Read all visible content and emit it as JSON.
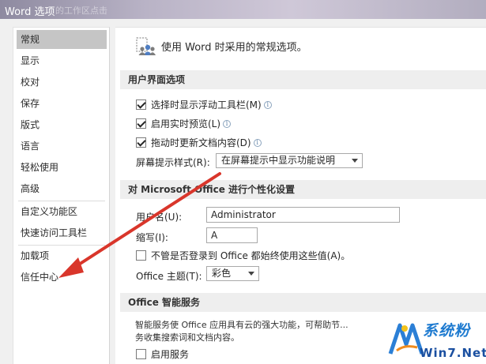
{
  "window": {
    "title": "Word 选项",
    "title_ghost": "的工作区点击"
  },
  "sidebar": {
    "items": [
      {
        "label": "常规",
        "selected": true
      },
      {
        "label": "显示"
      },
      {
        "label": "校对"
      },
      {
        "label": "保存"
      },
      {
        "label": "版式"
      },
      {
        "label": "语言"
      },
      {
        "label": "轻松使用"
      },
      {
        "label": "高级"
      },
      {
        "label": "自定义功能区"
      },
      {
        "label": "快速访问工具栏"
      },
      {
        "label": "加载项"
      },
      {
        "label": "信任中心"
      }
    ]
  },
  "main": {
    "header_text": "使用 Word 时采用的常规选项。",
    "header_icon": "general-options-icon",
    "ui_section": {
      "title": "用户界面选项",
      "options": [
        {
          "label": "选择时显示浮动工具栏(M)",
          "checked": true
        },
        {
          "label": "启用实时预览(L)",
          "checked": true
        },
        {
          "label": "拖动时更新文档内容(D)",
          "checked": true
        }
      ],
      "screentip_label": "屏幕提示样式(R):",
      "screentip_value": "在屏幕提示中显示功能说明"
    },
    "personalize_section": {
      "title": "对 Microsoft Office 进行个性化设置",
      "username_label": "用户名(U):",
      "username_value": "Administrator",
      "initials_label": "缩写(I):",
      "initials_value": "A",
      "always_use_label": "不管是否登录到 Office 都始终使用这些值(A)。",
      "always_use_checked": false,
      "theme_label": "Office 主题(T):",
      "theme_value": "彩色"
    },
    "smart_section": {
      "title": "Office 智能服务",
      "desc_line1": "智能服务使 Office 应用具有云的强大功能，可帮助节...",
      "desc_line2": "务收集搜索词和文档内容。",
      "enable_label": "启用服务",
      "enable_checked": false
    }
  },
  "watermark": {
    "brand": "系统粉",
    "url": "Win7.Net"
  },
  "colors": {
    "arrow": "#d9362b",
    "selected_nav": "#c5c5c5",
    "section_bg": "#eeeeee"
  }
}
